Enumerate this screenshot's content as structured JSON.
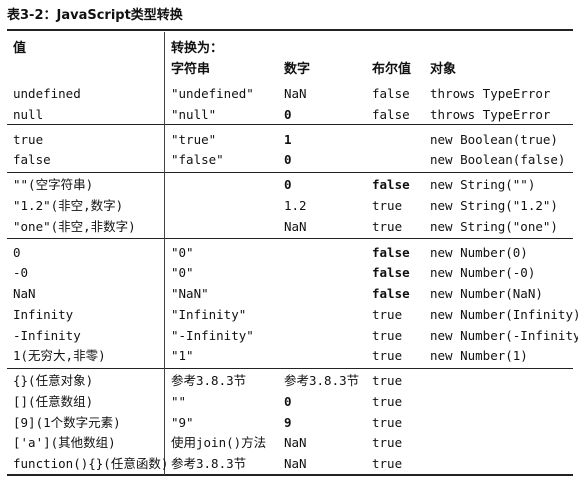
{
  "caption": "表3-2：JavaScript类型转换",
  "headers": {
    "value": "值",
    "convert_to": "转换为：",
    "string": "字符串",
    "number": "数字",
    "boolean": "布尔值",
    "object": "对象"
  },
  "rows": [
    {
      "value": "undefined",
      "string": "\"undefined\"",
      "number": "NaN",
      "boolean": "false",
      "object": "throws TypeError"
    },
    {
      "value": "null",
      "string": "\"null\"",
      "number": "0",
      "boolean": "false",
      "object": "throws TypeError"
    },
    {
      "value": "true",
      "string": "\"true\"",
      "number": "1",
      "boolean": "",
      "object": "new Boolean(true)"
    },
    {
      "value": "false",
      "string": "\"false\"",
      "number": "0",
      "boolean": "",
      "object": "new Boolean(false)"
    },
    {
      "value": "\"\"(空字符串)",
      "string": "",
      "number": "0",
      "boolean": "false",
      "object": "new String(\"\")"
    },
    {
      "value": "\"1.2\"(非空,数字)",
      "string": "",
      "number": "1.2",
      "boolean": "true",
      "object": "new String(\"1.2\")"
    },
    {
      "value": "\"one\"(非空,非数字)",
      "string": "",
      "number": "NaN",
      "boolean": "true",
      "object": "new String(\"one\")"
    },
    {
      "value": "0",
      "string": "\"0\"",
      "number": "",
      "boolean": "false",
      "object": "new Number(0)"
    },
    {
      "value": "-0",
      "string": "\"0\"",
      "number": "",
      "boolean": "false",
      "object": "new Number(-0)"
    },
    {
      "value": "NaN",
      "string": "\"NaN\"",
      "number": "",
      "boolean": "false",
      "object": "new Number(NaN)"
    },
    {
      "value": "Infinity",
      "string": "\"Infinity\"",
      "number": "",
      "boolean": "true",
      "object": "new Number(Infinity)"
    },
    {
      "value": "-Infinity",
      "string": "\"-Infinity\"",
      "number": "",
      "boolean": "true",
      "object": "new Number(-Infinity)"
    },
    {
      "value": "1(无穷大,非零)",
      "string": "\"1\"",
      "number": "",
      "boolean": "true",
      "object": "new Number(1)"
    },
    {
      "value": "{}(任意对象)",
      "string": "参考3.8.3节",
      "number": "参考3.8.3节",
      "boolean": "true",
      "object": ""
    },
    {
      "value": "[](任意数组)",
      "string": "\"\"",
      "number": "0",
      "boolean": "true",
      "object": ""
    },
    {
      "value": "[9](1个数字元素)",
      "string": "\"9\"",
      "number": "9",
      "boolean": "true",
      "object": ""
    },
    {
      "value": "['a'](其他数组)",
      "string": "使用join()方法",
      "number": "NaN",
      "boolean": "true",
      "object": ""
    },
    {
      "value": "function(){}(任意函数)",
      "string": "参考3.8.3节",
      "number": "NaN",
      "boolean": "true",
      "object": ""
    }
  ]
}
